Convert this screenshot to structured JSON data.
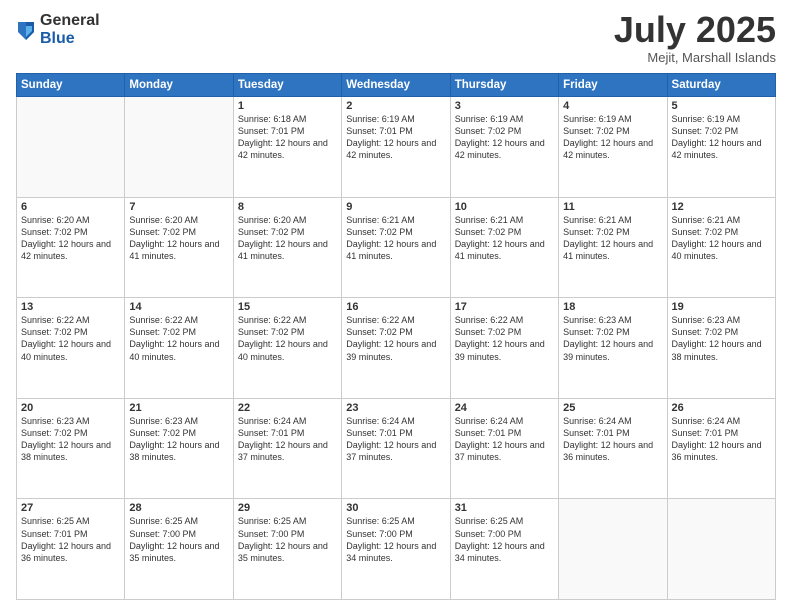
{
  "logo": {
    "general": "General",
    "blue": "Blue"
  },
  "header": {
    "month": "July 2025",
    "location": "Mejit, Marshall Islands"
  },
  "days_of_week": [
    "Sunday",
    "Monday",
    "Tuesday",
    "Wednesday",
    "Thursday",
    "Friday",
    "Saturday"
  ],
  "weeks": [
    [
      {
        "day": "",
        "info": ""
      },
      {
        "day": "",
        "info": ""
      },
      {
        "day": "1",
        "info": "Sunrise: 6:18 AM\nSunset: 7:01 PM\nDaylight: 12 hours and 42 minutes."
      },
      {
        "day": "2",
        "info": "Sunrise: 6:19 AM\nSunset: 7:01 PM\nDaylight: 12 hours and 42 minutes."
      },
      {
        "day": "3",
        "info": "Sunrise: 6:19 AM\nSunset: 7:02 PM\nDaylight: 12 hours and 42 minutes."
      },
      {
        "day": "4",
        "info": "Sunrise: 6:19 AM\nSunset: 7:02 PM\nDaylight: 12 hours and 42 minutes."
      },
      {
        "day": "5",
        "info": "Sunrise: 6:19 AM\nSunset: 7:02 PM\nDaylight: 12 hours and 42 minutes."
      }
    ],
    [
      {
        "day": "6",
        "info": "Sunrise: 6:20 AM\nSunset: 7:02 PM\nDaylight: 12 hours and 42 minutes."
      },
      {
        "day": "7",
        "info": "Sunrise: 6:20 AM\nSunset: 7:02 PM\nDaylight: 12 hours and 41 minutes."
      },
      {
        "day": "8",
        "info": "Sunrise: 6:20 AM\nSunset: 7:02 PM\nDaylight: 12 hours and 41 minutes."
      },
      {
        "day": "9",
        "info": "Sunrise: 6:21 AM\nSunset: 7:02 PM\nDaylight: 12 hours and 41 minutes."
      },
      {
        "day": "10",
        "info": "Sunrise: 6:21 AM\nSunset: 7:02 PM\nDaylight: 12 hours and 41 minutes."
      },
      {
        "day": "11",
        "info": "Sunrise: 6:21 AM\nSunset: 7:02 PM\nDaylight: 12 hours and 41 minutes."
      },
      {
        "day": "12",
        "info": "Sunrise: 6:21 AM\nSunset: 7:02 PM\nDaylight: 12 hours and 40 minutes."
      }
    ],
    [
      {
        "day": "13",
        "info": "Sunrise: 6:22 AM\nSunset: 7:02 PM\nDaylight: 12 hours and 40 minutes."
      },
      {
        "day": "14",
        "info": "Sunrise: 6:22 AM\nSunset: 7:02 PM\nDaylight: 12 hours and 40 minutes."
      },
      {
        "day": "15",
        "info": "Sunrise: 6:22 AM\nSunset: 7:02 PM\nDaylight: 12 hours and 40 minutes."
      },
      {
        "day": "16",
        "info": "Sunrise: 6:22 AM\nSunset: 7:02 PM\nDaylight: 12 hours and 39 minutes."
      },
      {
        "day": "17",
        "info": "Sunrise: 6:22 AM\nSunset: 7:02 PM\nDaylight: 12 hours and 39 minutes."
      },
      {
        "day": "18",
        "info": "Sunrise: 6:23 AM\nSunset: 7:02 PM\nDaylight: 12 hours and 39 minutes."
      },
      {
        "day": "19",
        "info": "Sunrise: 6:23 AM\nSunset: 7:02 PM\nDaylight: 12 hours and 38 minutes."
      }
    ],
    [
      {
        "day": "20",
        "info": "Sunrise: 6:23 AM\nSunset: 7:02 PM\nDaylight: 12 hours and 38 minutes."
      },
      {
        "day": "21",
        "info": "Sunrise: 6:23 AM\nSunset: 7:02 PM\nDaylight: 12 hours and 38 minutes."
      },
      {
        "day": "22",
        "info": "Sunrise: 6:24 AM\nSunset: 7:01 PM\nDaylight: 12 hours and 37 minutes."
      },
      {
        "day": "23",
        "info": "Sunrise: 6:24 AM\nSunset: 7:01 PM\nDaylight: 12 hours and 37 minutes."
      },
      {
        "day": "24",
        "info": "Sunrise: 6:24 AM\nSunset: 7:01 PM\nDaylight: 12 hours and 37 minutes."
      },
      {
        "day": "25",
        "info": "Sunrise: 6:24 AM\nSunset: 7:01 PM\nDaylight: 12 hours and 36 minutes."
      },
      {
        "day": "26",
        "info": "Sunrise: 6:24 AM\nSunset: 7:01 PM\nDaylight: 12 hours and 36 minutes."
      }
    ],
    [
      {
        "day": "27",
        "info": "Sunrise: 6:25 AM\nSunset: 7:01 PM\nDaylight: 12 hours and 36 minutes."
      },
      {
        "day": "28",
        "info": "Sunrise: 6:25 AM\nSunset: 7:00 PM\nDaylight: 12 hours and 35 minutes."
      },
      {
        "day": "29",
        "info": "Sunrise: 6:25 AM\nSunset: 7:00 PM\nDaylight: 12 hours and 35 minutes."
      },
      {
        "day": "30",
        "info": "Sunrise: 6:25 AM\nSunset: 7:00 PM\nDaylight: 12 hours and 34 minutes."
      },
      {
        "day": "31",
        "info": "Sunrise: 6:25 AM\nSunset: 7:00 PM\nDaylight: 12 hours and 34 minutes."
      },
      {
        "day": "",
        "info": ""
      },
      {
        "day": "",
        "info": ""
      }
    ]
  ]
}
